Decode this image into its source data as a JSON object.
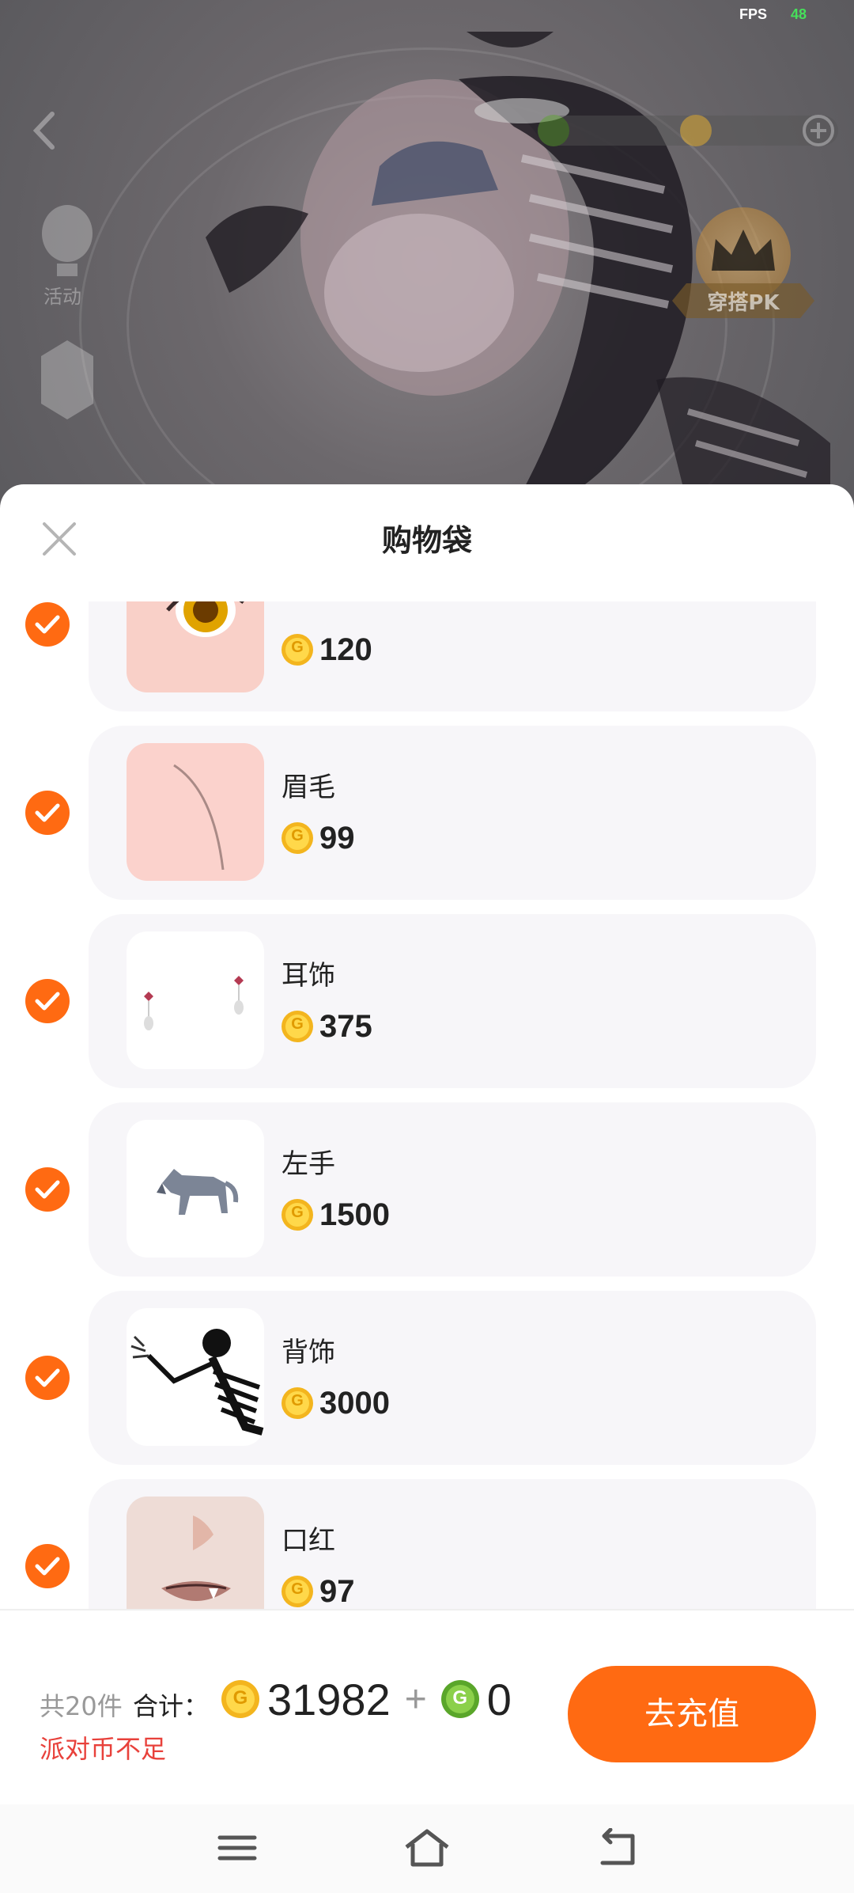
{
  "status": {
    "fps_label": "FPS",
    "fps_value": "48"
  },
  "background": {
    "pk_label": "穿搭PK",
    "side_label": "活动"
  },
  "sheet": {
    "title": "购物袋"
  },
  "items": [
    {
      "name": "",
      "price": "120",
      "coin_icon": "gold-coin-icon",
      "thumb": "eye-thumb"
    },
    {
      "name": "眉毛",
      "price": "99",
      "coin_icon": "gold-coin-icon",
      "thumb": "eyebrow-thumb"
    },
    {
      "name": "耳饰",
      "price": "375",
      "coin_icon": "gold-coin-icon",
      "thumb": "earring-thumb"
    },
    {
      "name": "左手",
      "price": "1500",
      "coin_icon": "gold-coin-icon",
      "thumb": "wolf-thumb"
    },
    {
      "name": "背饰",
      "price": "3000",
      "coin_icon": "gold-coin-icon",
      "thumb": "skeleton-thumb"
    },
    {
      "name": "口红",
      "price": "97",
      "coin_icon": "gold-coin-icon",
      "thumb": "lips-thumb"
    }
  ],
  "footer": {
    "count_text": "共20件",
    "total_label": "合计：",
    "gold_total": "31982",
    "plus": "+",
    "green_total": "0",
    "warning": "派对币不足",
    "recharge_label": "去充值"
  },
  "colors": {
    "accent": "#ff6a12",
    "warning": "#e8413b",
    "gold": "#f3b51e",
    "green": "#5aa62a"
  }
}
